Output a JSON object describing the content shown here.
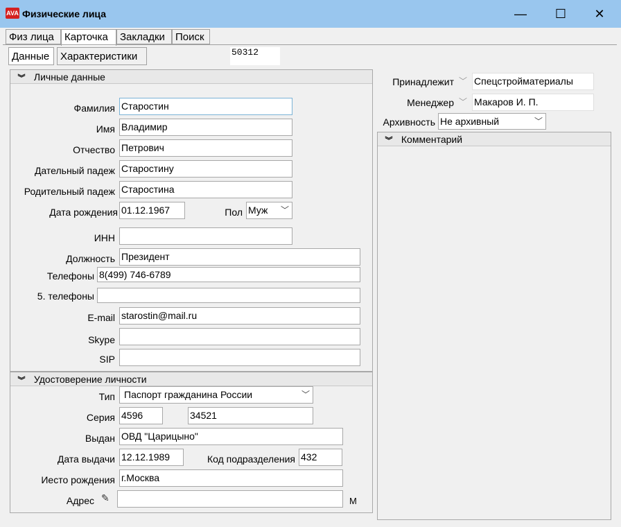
{
  "window": {
    "title": "Физические лица",
    "icon_text": "AVA"
  },
  "tabs": [
    "Физ лица",
    "Карточка",
    "Закладки",
    "Поиск"
  ],
  "subtabs": [
    "Данные",
    "Характеристики"
  ],
  "record_id": "50312",
  "personal": {
    "header": "Личные данные",
    "surname_label": "Фамилия",
    "surname": "Старостин",
    "name_label": "Имя",
    "name": "Владимир",
    "patronymic_label": "Отчество",
    "patronymic": "Петрович",
    "dative_label": "Дательный падеж",
    "dative": "Старостину",
    "genitive_label": "Родительный падеж",
    "genitive": "Старостина",
    "birthdate_label": "Дата рождения",
    "birthdate": "01.12.1967",
    "gender_label": "Пол",
    "gender": "Муж",
    "inn_label": "ИНН",
    "inn": "",
    "position_label": "Должность",
    "position": "Президент",
    "phones_label": "Телефоны",
    "phones": "8(499) 746-6789",
    "extra_phones_label": "5. телефоны",
    "extra_phones": "",
    "email_label": "E-mail",
    "email": "starostin@mail.ru",
    "skype_label": "Skype",
    "skype": "",
    "sip_label": "SIP",
    "sip": ""
  },
  "identity": {
    "header": "Удостоверение личности",
    "type_label": "Тип",
    "type": "Паспорт гражданина России",
    "series_label": "Серия",
    "series": "4596",
    "number": "34521",
    "issued_label": "Выдан",
    "issued": "ОВД \"Царицыно\"",
    "issue_date_label": "Дата выдачи",
    "issue_date": "12.12.1989",
    "dept_code_label": "Код подразделения",
    "dept_code": "432",
    "birthplace_label": "Иесто рождения",
    "birthplace": "г.Москва",
    "address_label": "Адрес",
    "address": "",
    "address_suffix": "М"
  },
  "right": {
    "owner_label": "Принадлежит",
    "owner": "Спецстройматериалы",
    "manager_label": "Менеджер",
    "manager": "Макаров И. П.",
    "archive_label": "Архивность",
    "archive": "Не архивный",
    "comment_header": "Комментарий"
  },
  "icons": {
    "chevron": "double-chevron-down-icon",
    "dropdown": "chevron-down-icon",
    "address_edit": "pencil-icon"
  }
}
